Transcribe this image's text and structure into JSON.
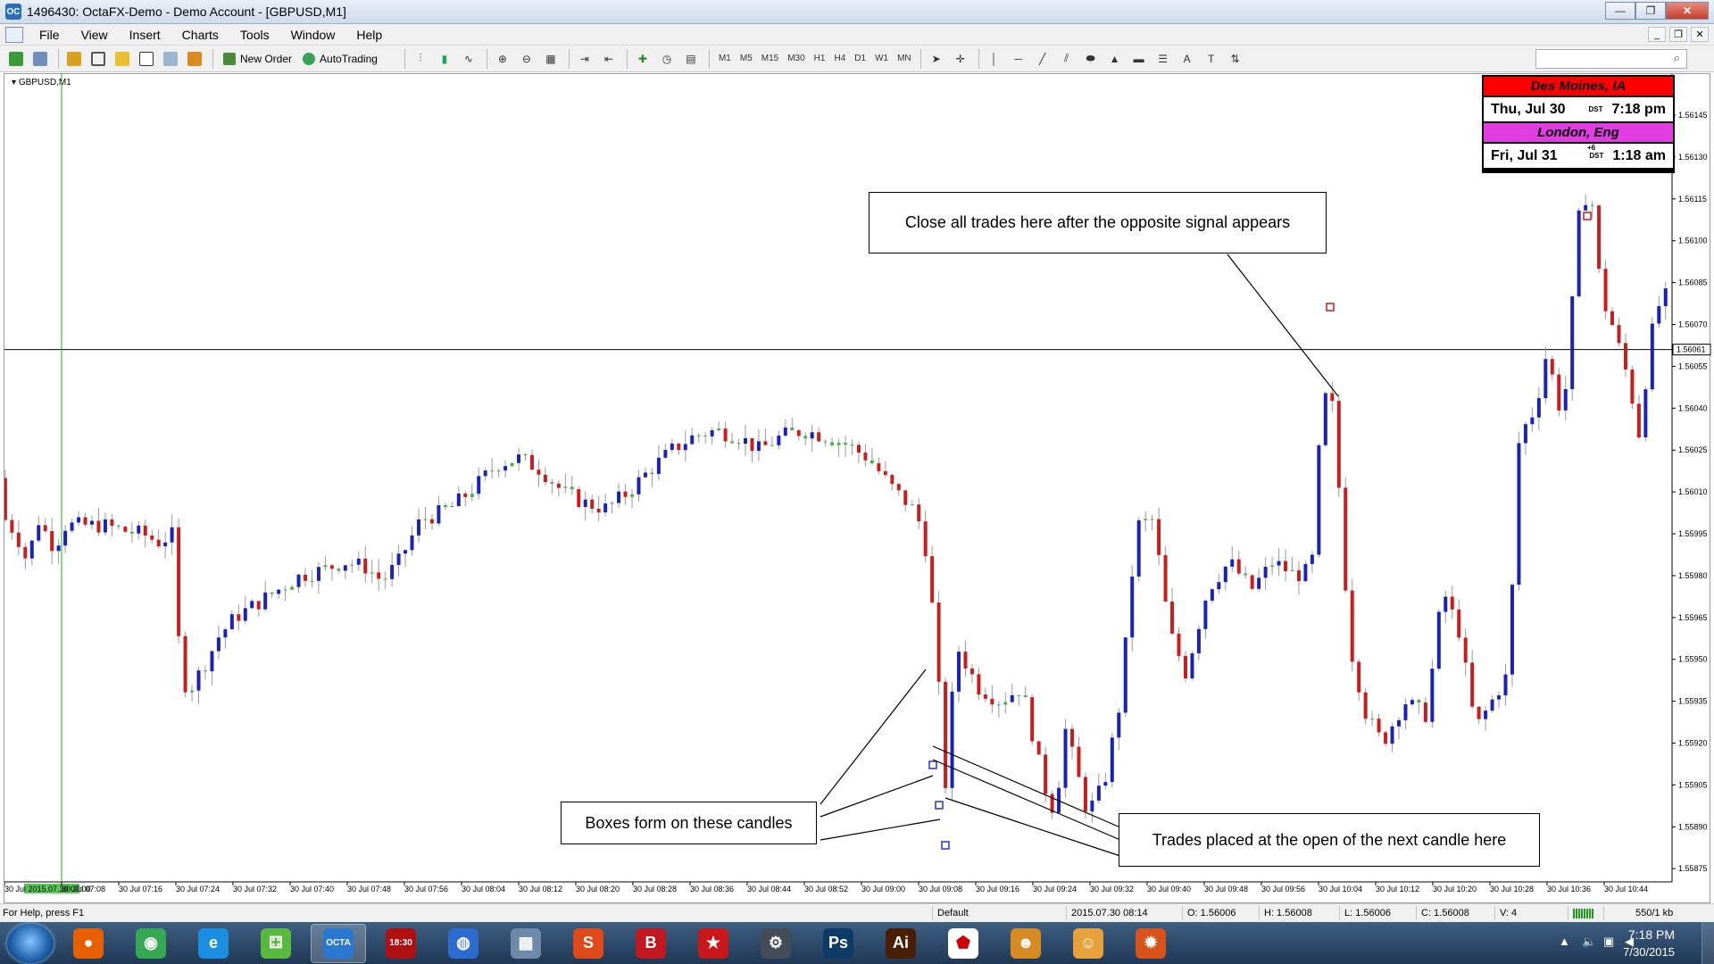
{
  "window": {
    "title": "1496430: OctaFX-Demo - Demo Account - [GBPUSD,M1]",
    "app_icon_text": "OC",
    "minimize": "—",
    "maximize": "❐",
    "close": "✕"
  },
  "menu": {
    "items": [
      "File",
      "View",
      "Insert",
      "Charts",
      "Tools",
      "Window",
      "Help"
    ],
    "mdi_minimize": "_",
    "mdi_restore": "❐",
    "mdi_close": "✕"
  },
  "toolbar": {
    "new_order": "New Order",
    "autotrading": "AutoTrading",
    "timeframes": [
      "M1",
      "M5",
      "M15",
      "M30",
      "H1",
      "H4",
      "D1",
      "W1",
      "MN"
    ],
    "search_placeholder": ""
  },
  "chart": {
    "symbol": "GBPUSD,M1",
    "current_price": "1.56061",
    "price_ticks": [
      "1.56145",
      "1.56130",
      "1.56115",
      "1.56100",
      "1.56085",
      "1.56070",
      "1.56055",
      "1.56040",
      "1.56025",
      "1.56010",
      "1.55995",
      "1.55980",
      "1.55965",
      "1.55950",
      "1.55935",
      "1.55920",
      "1.55905",
      "1.55890",
      "1.55875"
    ],
    "time_ticks": [
      "30 Jul 2015.07.30 07:00",
      "30 Jul 07:08",
      "30 Jul 07:16",
      "30 Jul 07:24",
      "30 Jul 07:32",
      "30 Jul 07:40",
      "30 Jul 07:48",
      "30 Jul 07:56",
      "30 Jul 08:04",
      "30 Jul 08:12",
      "30 Jul 08:20",
      "30 Jul 08:28",
      "30 Jul 08:36",
      "30 Jul 08:44",
      "30 Jul 08:52",
      "30 Jul 09:00",
      "30 Jul 09:08",
      "30 Jul 09:16",
      "30 Jul 09:24",
      "30 Jul 09:32",
      "30 Jul 09:40",
      "30 Jul 09:48",
      "30 Jul 09:56",
      "30 Jul 10:04",
      "30 Jul 10:12",
      "30 Jul 10:20",
      "30 Jul 10:28",
      "30 Jul 10:36",
      "30 Jul 10:44"
    ],
    "colors": {
      "bull": "#1a22b8",
      "bear": "#c81e1e",
      "doji": "#4caf50",
      "vline": "#22aa22"
    }
  },
  "clock": {
    "city1": "Des Moines, IA",
    "day1": "Thu, Jul 30",
    "dst1": "DST",
    "time1": "7:18 pm",
    "city2": "London, Eng",
    "day2": "Fri, Jul 31",
    "offset2": "+6",
    "dst2": "DST",
    "time2": "1:18 am"
  },
  "annotations": {
    "close_trades": "Close all trades here after the opposite signal appears",
    "boxes_form": "Boxes form on these candles",
    "trades_placed": "Trades placed at the open of the next candle here"
  },
  "statusbar": {
    "help": "For Help, press F1",
    "profile": "Default",
    "datetime": "2015.07.30 08:14",
    "open": "O: 1.56006",
    "high": "H: 1.56008",
    "low": "L: 1.56006",
    "close": "C: 1.56008",
    "volume": "V: 4",
    "traffic": "550/1 kb"
  },
  "taskbar": {
    "clock_time": "7:18 PM",
    "clock_date": "7/30/2015",
    "apps": [
      {
        "name": "firefox",
        "color": "#e66000",
        "glyph": "●"
      },
      {
        "name": "chrome",
        "color": "#34a853",
        "glyph": "◉"
      },
      {
        "name": "ie",
        "color": "#1a8ee0",
        "glyph": "e"
      },
      {
        "name": "dice",
        "color": "#58b93e",
        "glyph": "⚃"
      },
      {
        "name": "octafx",
        "color": "#2a78d0",
        "glyph": "OCTA"
      },
      {
        "name": "clock",
        "color": "#b01010",
        "glyph": "18:30"
      },
      {
        "name": "earth",
        "color": "#2d6bcf",
        "glyph": "◍"
      },
      {
        "name": "calculator",
        "color": "#6d8aa8",
        "glyph": "▦"
      },
      {
        "name": "s-app",
        "color": "#e04a1a",
        "glyph": "S"
      },
      {
        "name": "b-app",
        "color": "#c0181e",
        "glyph": "B"
      },
      {
        "name": "poker",
        "color": "#c8181c",
        "glyph": "★"
      },
      {
        "name": "steam",
        "color": "#444c58",
        "glyph": "⚙"
      },
      {
        "name": "photoshop",
        "color": "#0b3b66",
        "glyph": "Ps"
      },
      {
        "name": "illustrator",
        "color": "#4a1d05",
        "glyph": "Ai"
      },
      {
        "name": "pdf",
        "color": "#ffffff",
        "glyph": "⬟"
      },
      {
        "name": "mascot1",
        "color": "#d58a22",
        "glyph": "☻"
      },
      {
        "name": "mascot2",
        "color": "#e6a13a",
        "glyph": "☺"
      },
      {
        "name": "fire",
        "color": "#d8531a",
        "glyph": "✹"
      }
    ]
  }
}
